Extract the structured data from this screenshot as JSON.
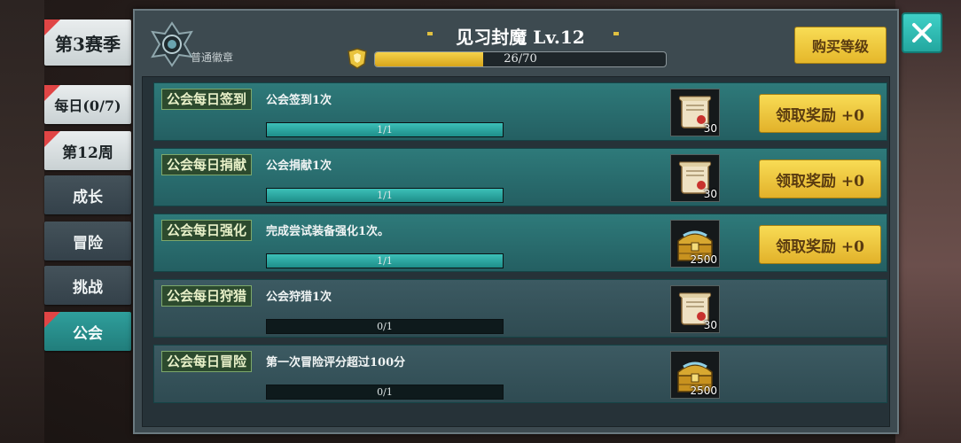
{
  "tabs": [
    {
      "label": "第3赛季",
      "flag": true,
      "style": "light"
    },
    {
      "label": "每日(0/7)",
      "flag": true,
      "style": "light"
    },
    {
      "label": "第12周",
      "flag": true,
      "style": "light"
    },
    {
      "label": "成长",
      "flag": false,
      "style": "dark"
    },
    {
      "label": "冒险",
      "flag": false,
      "style": "dark"
    },
    {
      "label": "挑战",
      "flag": false,
      "style": "dark"
    },
    {
      "label": "公会",
      "flag": true,
      "style": "active"
    }
  ],
  "header": {
    "badge_label": "普通徽章",
    "title": "见习封魔 Lv.12",
    "xp_text": "26/70",
    "xp_progress": 0.371,
    "buy_label": "购买等级"
  },
  "quests": [
    {
      "tag": "公会每日签到",
      "desc": "公会签到1次",
      "progress_text": "1/1",
      "progress": 1.0,
      "reward_icon": "scroll-icon",
      "reward_qty": "30",
      "claim_label": "领取奖励 +0",
      "claimable": true
    },
    {
      "tag": "公会每日捐献",
      "desc": "公会捐献1次",
      "progress_text": "1/1",
      "progress": 1.0,
      "reward_icon": "scroll-icon",
      "reward_qty": "30",
      "claim_label": "领取奖励 +0",
      "claimable": true
    },
    {
      "tag": "公会每日强化",
      "desc": "完成尝试装备强化1次。",
      "progress_text": "1/1",
      "progress": 1.0,
      "reward_icon": "treasure-chest-icon",
      "reward_qty": "2500",
      "claim_label": "领取奖励 +0",
      "claimable": true
    },
    {
      "tag": "公会每日狩猎",
      "desc": "公会狩猎1次",
      "progress_text": "0/1",
      "progress": 0.0,
      "reward_icon": "scroll-icon",
      "reward_qty": "30",
      "claim_label": "",
      "claimable": false
    },
    {
      "tag": "公会每日冒险",
      "desc": "第一次冒险评分超过100分",
      "progress_text": "0/1",
      "progress": 0.0,
      "reward_icon": "treasure-chest-icon",
      "reward_qty": "2500",
      "claim_label": "",
      "claimable": false
    }
  ],
  "colors": {
    "accent_teal": "#2f9f9c",
    "gold": "#f0c840",
    "flag_red": "#e04545"
  }
}
